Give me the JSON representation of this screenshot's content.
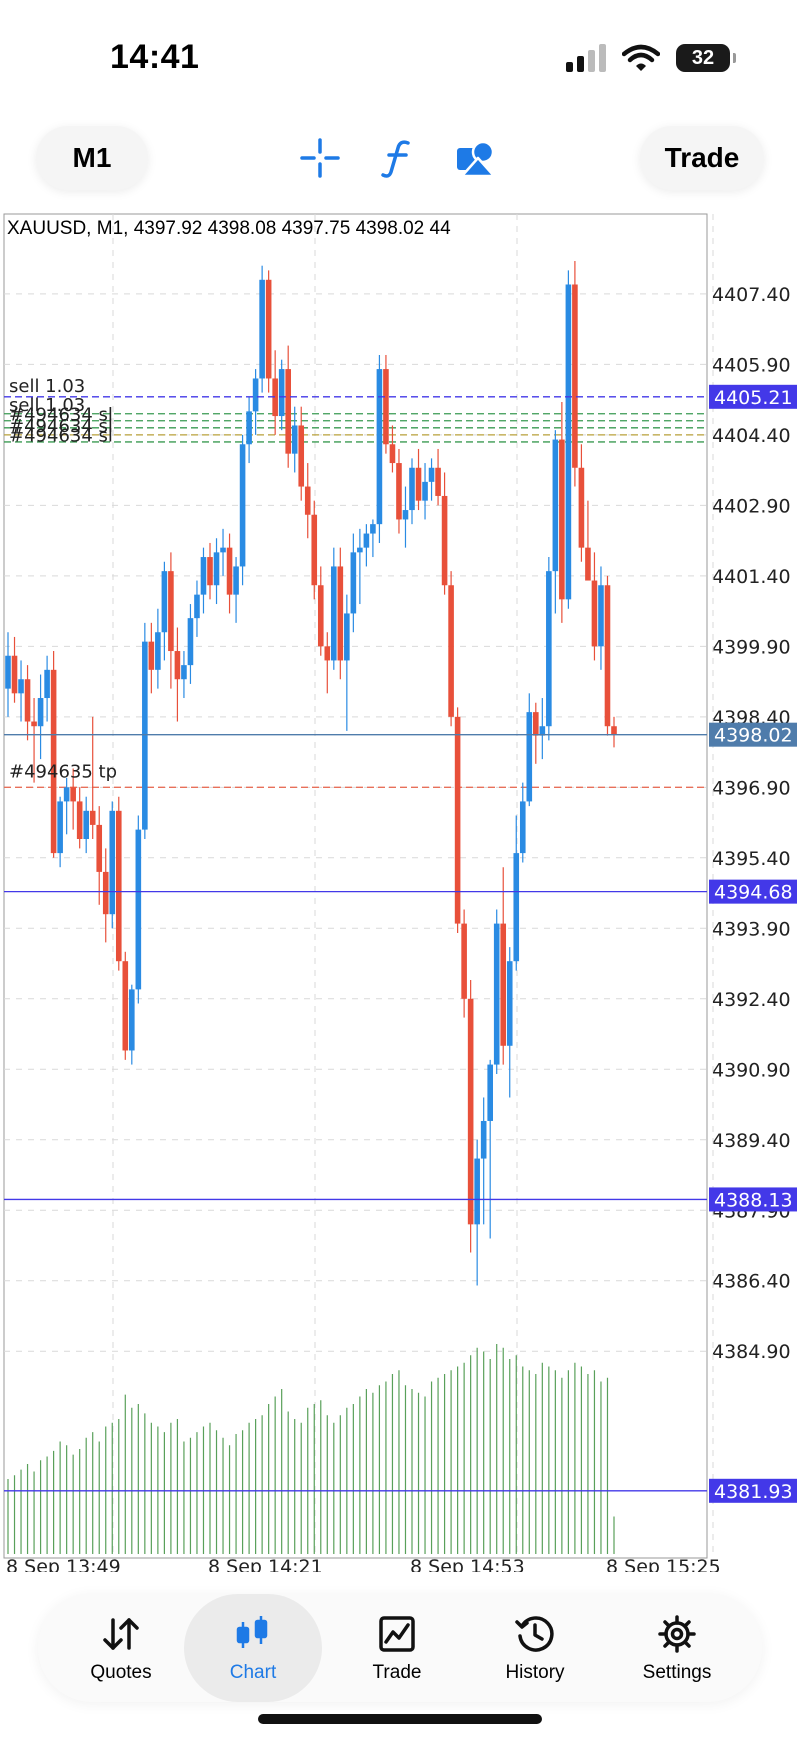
{
  "status": {
    "time": "14:41",
    "battery": "32"
  },
  "toolbar": {
    "timeframe": "M1",
    "trade_label": "Trade"
  },
  "chart_header": "XAUUSD, M1, 4397.92 4398.08 4397.75 4398.02 44",
  "chart_data": {
    "type": "candlestick",
    "symbol": "XAUUSD",
    "timeframe": "M1",
    "ylim": [
      4380.5,
      4409.1
    ],
    "y_ticks": [
      "4407.40",
      "4405.90",
      "4404.40",
      "4402.90",
      "4401.40",
      "4399.90",
      "4398.40",
      "4396.90",
      "4395.40",
      "4393.90",
      "4392.40",
      "4390.90",
      "4389.40",
      "4387.90",
      "4386.40",
      "4384.90"
    ],
    "x_ticks": [
      "8 Sep 13:49",
      "8 Sep 14:21",
      "8 Sep 14:53",
      "8 Sep 15:25"
    ],
    "price_tags": [
      {
        "label": "4405.21",
        "value": 4405.21,
        "color": "#4338e8",
        "line": "dashed"
      },
      {
        "label": "4398.02",
        "value": 4398.02,
        "color": "#4f7cab",
        "line": "solid"
      },
      {
        "label": "4394.68",
        "value": 4394.68,
        "color": "#4338e8",
        "line": "solid"
      },
      {
        "label": "4388.13",
        "value": 4388.13,
        "color": "#4338e8",
        "line": "solid"
      },
      {
        "label": "4381.93",
        "value": 4381.93,
        "color": "#4338e8",
        "line": "solid"
      }
    ],
    "order_labels": [
      {
        "text": "sell 1.03",
        "value": 4405.35
      },
      {
        "text": "sell 1.03",
        "value": 4404.95
      },
      {
        "text": "#494634 sl",
        "value": 4404.75
      },
      {
        "text": "#494634 sl",
        "value": 4404.5
      },
      {
        "text": "#494634 sl",
        "value": 4404.3
      },
      {
        "text": "#494635 tp",
        "value": 4397.15
      }
    ],
    "level_lines": [
      {
        "value": 4404.85,
        "color": "#3a9a52"
      },
      {
        "value": 4404.7,
        "color": "#3a9a52"
      },
      {
        "value": 4404.55,
        "color": "#3a9a52"
      },
      {
        "value": 4404.4,
        "color": "#b8a03a"
      },
      {
        "value": 4404.25,
        "color": "#3a9a52"
      },
      {
        "value": 4396.9,
        "color": "#e8705a"
      }
    ],
    "colors": {
      "up": "#2a8be3",
      "down": "#e8503a",
      "volume": "#59a05a",
      "grid": "#d9d9d9"
    },
    "candles": [
      [
        4399.0,
        4400.2,
        4398.4,
        4399.7
      ],
      [
        4399.7,
        4400.1,
        4398.7,
        4398.9
      ],
      [
        4398.9,
        4399.6,
        4398.3,
        4399.2
      ],
      [
        4399.2,
        4399.5,
        4397.9,
        4398.3
      ],
      [
        4398.3,
        4398.8,
        4397.0,
        4398.2
      ],
      [
        4398.2,
        4399.3,
        4397.5,
        4398.8
      ],
      [
        4398.8,
        4399.7,
        4398.3,
        4399.4
      ],
      [
        4399.4,
        4399.8,
        4395.4,
        4395.5
      ],
      [
        4395.5,
        4396.7,
        4395.2,
        4396.6
      ],
      [
        4396.6,
        4397.1,
        4395.9,
        4396.9
      ],
      [
        4396.9,
        4397.3,
        4396.0,
        4396.6
      ],
      [
        4396.6,
        4396.9,
        4395.6,
        4395.8
      ],
      [
        4395.8,
        4396.7,
        4395.5,
        4396.4
      ],
      [
        4396.4,
        4398.4,
        4395.8,
        4396.1
      ],
      [
        4396.1,
        4396.5,
        4394.4,
        4395.1
      ],
      [
        4395.1,
        4395.6,
        4393.6,
        4394.2
      ],
      [
        4394.2,
        4396.6,
        4393.9,
        4396.4
      ],
      [
        4396.4,
        4396.7,
        4393.0,
        4393.2
      ],
      [
        4393.2,
        4393.4,
        4391.1,
        4391.3
      ],
      [
        4391.3,
        4392.7,
        4391.0,
        4392.6
      ],
      [
        4392.6,
        4396.3,
        4392.3,
        4396.0
      ],
      [
        4396.0,
        4400.4,
        4395.8,
        4400.0
      ],
      [
        4400.0,
        4400.4,
        4398.9,
        4399.4
      ],
      [
        4399.4,
        4400.7,
        4399.0,
        4400.2
      ],
      [
        4400.2,
        4401.7,
        4399.6,
        4401.5
      ],
      [
        4401.5,
        4401.9,
        4399.0,
        4399.8
      ],
      [
        4399.8,
        4400.3,
        4398.3,
        4399.2
      ],
      [
        4399.2,
        4399.8,
        4398.8,
        4399.5
      ],
      [
        4399.5,
        4400.8,
        4399.1,
        4400.5
      ],
      [
        4400.5,
        4401.3,
        4400.1,
        4401.0
      ],
      [
        4401.0,
        4402.0,
        4400.6,
        4401.8
      ],
      [
        4401.8,
        4402.1,
        4400.9,
        4401.2
      ],
      [
        4401.2,
        4402.2,
        4400.8,
        4401.9
      ],
      [
        4401.9,
        4402.4,
        4401.4,
        4402.0
      ],
      [
        4402.0,
        4402.3,
        4400.6,
        4401.0
      ],
      [
        4401.0,
        4401.8,
        4400.4,
        4401.6
      ],
      [
        4401.6,
        4404.4,
        4401.2,
        4404.2
      ],
      [
        4404.2,
        4405.2,
        4403.8,
        4404.9
      ],
      [
        4404.9,
        4405.8,
        4404.4,
        4405.6
      ],
      [
        4405.6,
        4408.0,
        4405.3,
        4407.7
      ],
      [
        4407.7,
        4407.9,
        4405.3,
        4405.6
      ],
      [
        4405.6,
        4406.2,
        4404.4,
        4404.8
      ],
      [
        4404.8,
        4406.0,
        4404.5,
        4405.8
      ],
      [
        4405.8,
        4406.3,
        4403.7,
        4404.0
      ],
      [
        4404.0,
        4405.0,
        4403.6,
        4404.6
      ],
      [
        4404.6,
        4405.0,
        4403.0,
        4403.3
      ],
      [
        4403.3,
        4403.8,
        4402.2,
        4402.7
      ],
      [
        4402.7,
        4403.0,
        4400.9,
        4401.2
      ],
      [
        4401.2,
        4401.6,
        4399.7,
        4399.9
      ],
      [
        4399.9,
        4400.2,
        4398.9,
        4399.6
      ],
      [
        4399.6,
        4402.0,
        4399.4,
        4401.6
      ],
      [
        4401.6,
        4402.0,
        4399.2,
        4399.6
      ],
      [
        4399.6,
        4401.0,
        4398.1,
        4400.6
      ],
      [
        4400.6,
        4402.3,
        4400.2,
        4401.9
      ],
      [
        4401.9,
        4402.4,
        4400.8,
        4402.0
      ],
      [
        4402.0,
        4402.5,
        4401.6,
        4402.3
      ],
      [
        4402.3,
        4402.6,
        4401.8,
        4402.5
      ],
      [
        4402.5,
        4406.1,
        4402.1,
        4405.8
      ],
      [
        4405.8,
        4406.1,
        4404.0,
        4404.2
      ],
      [
        4404.2,
        4404.6,
        4403.6,
        4403.8
      ],
      [
        4403.8,
        4404.1,
        4402.3,
        4402.6
      ],
      [
        4402.6,
        4403.3,
        4402.0,
        4402.8
      ],
      [
        4402.8,
        4403.9,
        4402.5,
        4403.7
      ],
      [
        4403.7,
        4404.1,
        4402.8,
        4403.0
      ],
      [
        4403.0,
        4403.8,
        4402.6,
        4403.4
      ],
      [
        4403.4,
        4403.9,
        4403.0,
        4403.7
      ],
      [
        4403.7,
        4404.1,
        4402.9,
        4403.1
      ],
      [
        4403.1,
        4403.6,
        4401.0,
        4401.2
      ],
      [
        4401.2,
        4401.5,
        4398.2,
        4398.4
      ],
      [
        4398.4,
        4398.6,
        4393.8,
        4394.0
      ],
      [
        4394.0,
        4394.3,
        4392.0,
        4392.4
      ],
      [
        4392.4,
        4392.8,
        4387.0,
        4387.6
      ],
      [
        4387.6,
        4389.4,
        4386.3,
        4389.0
      ],
      [
        4389.0,
        4390.3,
        4387.6,
        4389.8
      ],
      [
        4389.8,
        4391.1,
        4387.3,
        4391.0
      ],
      [
        4391.0,
        4394.3,
        4390.8,
        4394.0
      ],
      [
        4394.0,
        4395.2,
        4391.0,
        4391.4
      ],
      [
        4391.4,
        4393.5,
        4390.3,
        4393.2
      ],
      [
        4393.2,
        4396.3,
        4393.0,
        4395.5
      ],
      [
        4395.5,
        4397.0,
        4395.3,
        4396.6
      ],
      [
        4396.6,
        4398.9,
        4396.5,
        4398.5
      ],
      [
        4398.5,
        4398.7,
        4397.4,
        4398.0
      ],
      [
        4398.0,
        4398.8,
        4397.5,
        4398.2
      ],
      [
        4398.2,
        4401.8,
        4397.9,
        4401.5
      ],
      [
        4401.5,
        4404.5,
        4400.6,
        4404.3
      ],
      [
        4404.3,
        4405.1,
        4400.4,
        4400.9
      ],
      [
        4400.9,
        4407.9,
        4400.7,
        4407.6
      ],
      [
        4407.6,
        4408.1,
        4403.3,
        4403.7
      ],
      [
        4403.7,
        4404.2,
        4401.7,
        4402.0
      ],
      [
        4402.0,
        4403.0,
        4401.7,
        4401.3
      ],
      [
        4401.3,
        4401.9,
        4399.6,
        4399.9
      ],
      [
        4399.9,
        4401.6,
        4399.4,
        4401.2
      ],
      [
        4401.2,
        4401.4,
        4398.0,
        4398.2
      ],
      [
        4398.2,
        4398.4,
        4397.75,
        4398.02
      ]
    ],
    "volume": [
      40,
      42,
      45,
      48,
      44,
      50,
      52,
      55,
      60,
      58,
      53,
      56,
      62,
      65,
      60,
      68,
      70,
      72,
      85,
      78,
      80,
      75,
      70,
      68,
      65,
      70,
      72,
      60,
      62,
      65,
      68,
      70,
      66,
      62,
      58,
      64,
      66,
      70,
      72,
      74,
      80,
      84,
      88,
      76,
      72,
      70,
      78,
      80,
      82,
      74,
      70,
      74,
      78,
      80,
      84,
      88,
      86,
      90,
      92,
      96,
      98,
      90,
      88,
      86,
      84,
      92,
      94,
      96,
      98,
      100,
      102,
      106,
      110,
      108,
      104,
      112,
      110,
      104,
      106,
      100,
      98,
      96,
      102,
      100,
      98,
      94,
      98,
      102,
      100,
      96,
      98,
      92,
      94,
      20
    ]
  },
  "tabbar": {
    "quotes": "Quotes",
    "chart": "Chart",
    "trade": "Trade",
    "history": "History",
    "settings": "Settings"
  }
}
